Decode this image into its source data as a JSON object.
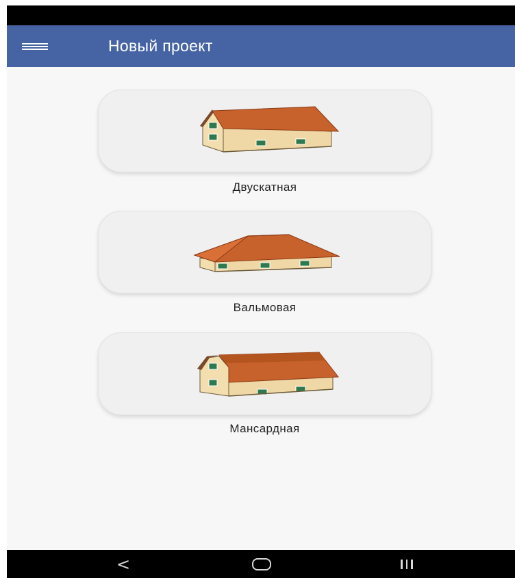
{
  "app_bar": {
    "title": "Новый проект",
    "menu_icon": "hamburger-menu-icon",
    "background": "#4664a3"
  },
  "roof_types": [
    {
      "label": "Двускатная",
      "icon": "gable-roof-house-icon"
    },
    {
      "label": "Вальмовая",
      "icon": "hip-roof-house-icon"
    },
    {
      "label": "Мансардная",
      "icon": "mansard-roof-house-icon"
    }
  ],
  "nav_bar": {
    "back_icon": "back-chevron-icon",
    "home_icon": "home-pill-icon",
    "recents_icon": "recent-apps-icon"
  },
  "colors": {
    "roof": "#c8622c",
    "wall": "#f3deb0",
    "shutter": "#2e7a4e"
  }
}
